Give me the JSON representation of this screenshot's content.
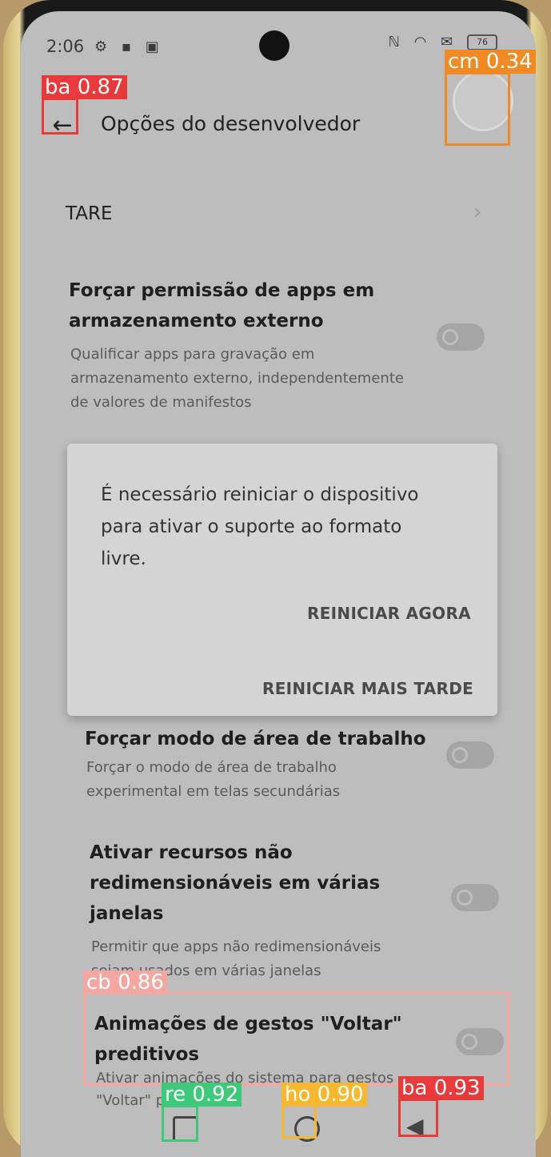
{
  "status_bar": {
    "time": "2:06",
    "left_icons": "⚙ ▪ ▣",
    "right_icons": "ℕ ◠ ✉",
    "battery": "76"
  },
  "app_bar": {
    "title": "Opções do desenvolvedor",
    "back_glyph": "←"
  },
  "settings": {
    "tare_label": "TARE",
    "chevron": "›",
    "external_storage": {
      "title_line1": "Forçar permissão de apps em",
      "title_line2": "armazenamento externo",
      "desc_line1": "Qualificar apps para gravação em",
      "desc_line2": "armazenamento externo, independentemente",
      "desc_line3": "de valores de manifestos"
    },
    "desktop_mode": {
      "title": "Forçar modo de área de trabalho",
      "desc_line1": "Forçar o modo de área de trabalho",
      "desc_line2": "experimental em telas secundárias"
    },
    "non_resizable": {
      "title_line1": "Ativar recursos não",
      "title_line2": "redimensionáveis em várias",
      "title_line3": "janelas",
      "desc_line1": "Permitir que apps não redimensionáveis",
      "desc_line2": "sejam usados em várias janelas"
    },
    "predictive_back": {
      "title_line1": "Animações de gestos \"Voltar\"",
      "title_line2": "preditivos",
      "desc_line1": "Ativar animações do sistema para gestos",
      "desc_line2": "\"Voltar\" pr..."
    }
  },
  "dialog": {
    "message_line1": "É necessário reiniciar o dispositivo",
    "message_line2": "para ativar o suporte ao formato",
    "message_line3": "livre.",
    "reboot_now": "REINICIAR AGORA",
    "reboot_later": "REINICIAR MAIS TARDE"
  },
  "detections": {
    "back_top": "ba 0.87",
    "avatar": "cm 0.34",
    "checkbox": "cb 0.86",
    "recent": "re 0.92",
    "home": "ho 0.90",
    "back_nav": "ba 0.93"
  },
  "colors": {
    "det_red": "#e83a3a",
    "det_orange": "#f08a24",
    "det_pink": "#f4a6a0",
    "det_green": "#3ec97a",
    "det_yellow": "#f5b82e"
  }
}
